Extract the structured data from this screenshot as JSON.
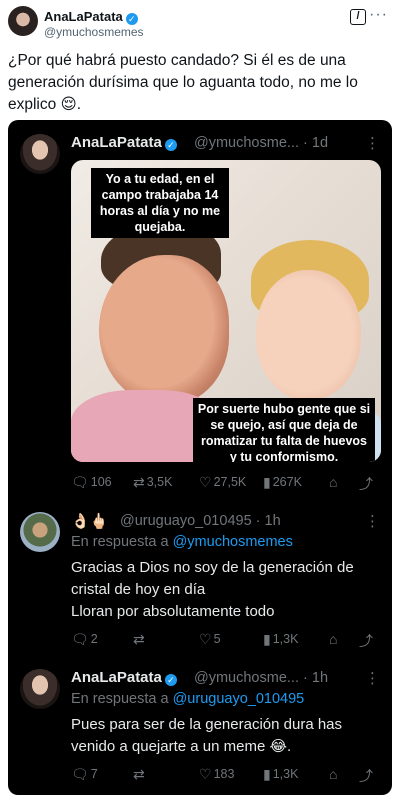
{
  "outer_tweet": {
    "name": "AnaLaPatata",
    "handle": "@ymuchosmemes",
    "verified_glyph": "✓",
    "grok_glyph": "/",
    "more_glyph": "···",
    "text": "¿Por qué habrá puesto candado? Si él es de una generación durísima que lo aguanta todo, no me lo explico 😌."
  },
  "quoted_thread": {
    "original": {
      "name": "AnaLaPatata",
      "handle": "@ymuchosme...",
      "time": "1d",
      "more_glyph": "⋮",
      "meme": {
        "top_caption": "Yo a tu edad, en el campo trabajaba 14 horas al día y no me quejaba.",
        "bottom_caption": "Por suerte hubo gente que si se quejo, así que deja de romatizar tu falta de huevos y tu conformismo."
      },
      "stats": {
        "replies": "106",
        "reposts": "3,5K",
        "likes": "27,5K",
        "views": "267K"
      }
    },
    "reply_1": {
      "name": "👌🏻🖕🏻",
      "handle": "@uruguayo_010495",
      "time": "1h",
      "more_glyph": "⋮",
      "reply_prefix": "En respuesta a",
      "reply_target": "@ymuchosmemes",
      "text_line_1": "Gracias a Dios no soy de la generación de cristal de hoy en día",
      "text_line_2": "Lloran por absolutamente todo",
      "stats": {
        "replies": "2",
        "reposts": "",
        "likes": "5",
        "views": "1,3K"
      }
    },
    "reply_2": {
      "name": "AnaLaPatata",
      "handle": "@ymuchosme...",
      "time": "1h",
      "more_glyph": "⋮",
      "reply_prefix": "En respuesta a",
      "reply_target": "@uruguayo_010495",
      "text": "Pues para ser de la generación dura has venido a quejarte a un meme 😂.",
      "stats": {
        "replies": "7",
        "reposts": "",
        "likes": "183",
        "views": "1,3K"
      }
    }
  },
  "icons": {
    "reply": "reply-icon",
    "repost": "repost-icon",
    "like": "heart-icon",
    "views": "views-icon",
    "bookmark": "bookmark-icon",
    "share": "share-icon"
  },
  "colors": {
    "link": "#1d9bf0",
    "muted": "#71767b",
    "dark_bg": "#000000"
  }
}
